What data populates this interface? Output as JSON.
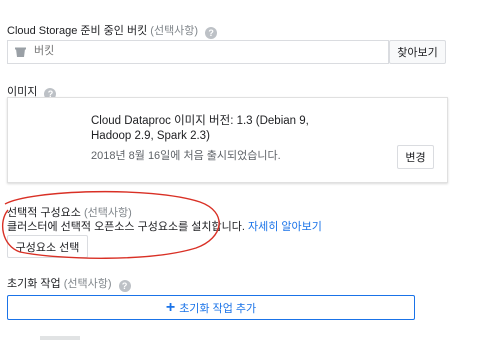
{
  "bucket": {
    "label": "Cloud Storage 준비 중인 버킷",
    "optional": "(선택사항)",
    "placeholder": "버킷",
    "browse_label": "찾아보기"
  },
  "image": {
    "label": "이미지",
    "version_line1": "Cloud Dataproc 이미지 버전: 1.3 (Debian 9,",
    "version_line2": "Hadoop 2.9, Spark 2.3)",
    "release_note": "2018년 8월 16일에 처음 출시되었습니다.",
    "change_label": "변경"
  },
  "components": {
    "label": "선택적 구성요소",
    "optional": "(선택사항)",
    "description": "클러스터에 선택적 오픈소스 구성요소를 설치합니다.",
    "learn_more": "자세히 알아보기",
    "select_label": "구성요소 선택"
  },
  "init": {
    "label": "초기화 작업",
    "optional": "(선택사항)",
    "add_label": "초기화 작업 추가"
  },
  "colors": {
    "accent": "#1a73e8",
    "annotation": "#d93025"
  }
}
